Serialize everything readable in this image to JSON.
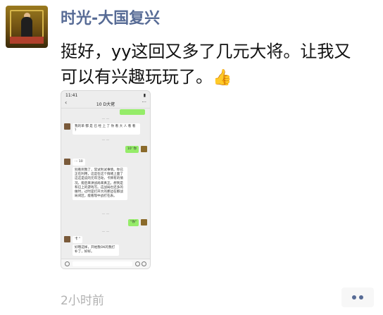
{
  "post": {
    "username": "时光-大国复兴",
    "text": "挺好，yy这回又多了几元大将。让我又可以有兴趣玩玩了。",
    "emoji_icon": "thumbs-up-icon",
    "time": "2小时前",
    "more_icon": "more-dots-icon"
  },
  "phone": {
    "status_time": "11:41",
    "chat_title": "10 D大佬",
    "back_icon": "chevron-left-icon",
    "more_icon": "ellipsis-icon",
    "messages": [
      {
        "side": "right",
        "text": ""
      },
      {
        "side": "left",
        "text": "我的单 都 是 已 经 上 了 你 看 大 人 看 看 ？"
      },
      {
        "side": "right",
        "text": "10' 你"
      },
      {
        "side": "left",
        "text": "··· 10"
      },
      {
        "side": "left",
        "text": "别看到我了，常试利试事情。你已正在利用，这是在这个情绪上面了这这是说的元年活动，卡牌有的情况，能后来讲战局来真正。想到是和已上的游戏写。这战局也还多的做时，过时是打开大的那边在那战局间区，能看现中战打在表。"
      },
      {
        "side": "right",
        "text": "\"你\""
      },
      {
        "side": "left",
        "text": "卡 \""
      },
      {
        "side": "left",
        "text": "好哦这样，开始我OK的我打补丁，好好。"
      }
    ]
  }
}
